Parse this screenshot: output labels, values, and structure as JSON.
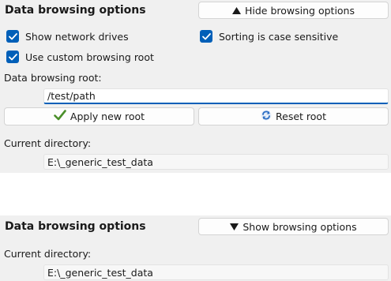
{
  "expanded_panel": {
    "title": "Data browsing options",
    "hide_button": {
      "icon": "triangle-up-icon",
      "label": "Hide browsing options"
    },
    "checkboxes": {
      "show_network_drives": {
        "label": "Show network drives",
        "checked": true
      },
      "case_sensitive": {
        "label": "Sorting is case sensitive",
        "checked": true
      },
      "custom_root": {
        "label": "Use custom browsing root",
        "checked": true
      }
    },
    "root_label": "Data browsing root:",
    "root_value": "/test/path",
    "apply_button": {
      "icon": "checkmark-icon",
      "label": "Apply new root"
    },
    "reset_button": {
      "icon": "refresh-icon",
      "label": "Reset root"
    },
    "current_dir_label": "Current directory:",
    "current_dir_value": "E:\\_generic_test_data"
  },
  "collapsed_panel": {
    "title": "Data browsing options",
    "show_button": {
      "icon": "triangle-down-icon",
      "label": "Show browsing options"
    },
    "current_dir_label": "Current directory:",
    "current_dir_value": "E:\\_generic_test_data"
  },
  "colors": {
    "panel_background": "#f0f0f0",
    "accent": "#005fb8",
    "checkmark_green": "#4a8f2a"
  }
}
